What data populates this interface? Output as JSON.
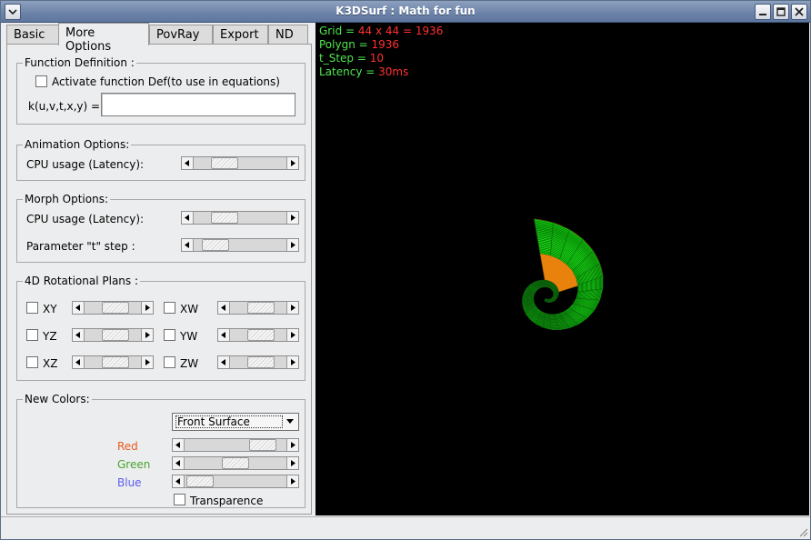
{
  "window": {
    "title": "K3DSurf : Math for fun",
    "colors": {
      "titlebar": "#6b82a8",
      "panel_bg": "#ecedee",
      "view_bg": "#000000"
    }
  },
  "tabs": [
    {
      "label": "Basic"
    },
    {
      "label": "More Options",
      "active": true
    },
    {
      "label": "PovRay"
    },
    {
      "label": "Export"
    },
    {
      "label": "ND"
    }
  ],
  "function_def": {
    "title": "Function Definition :",
    "activate_label": "Activate function Def(to use in equations)",
    "activate_checked": false,
    "k_label": "k(u,v,t,x,y) =",
    "k_value": ""
  },
  "animation": {
    "title": "Animation Options:",
    "cpu_label": "CPU usage (Latency):",
    "cpu_slider_value": 0.25
  },
  "morph": {
    "title": "Morph Options:",
    "cpu_label": "CPU usage (Latency):",
    "cpu_slider_value": 0.25,
    "tstep_label": "Parameter \"t\" step    :",
    "tstep_slider_value": 0.12
  },
  "rotational": {
    "title": "4D Rotational Plans :",
    "planes": [
      {
        "label": "XY",
        "checked": false,
        "value": 0.5
      },
      {
        "label": "XW",
        "checked": false,
        "value": 0.5
      },
      {
        "label": "YZ",
        "checked": false,
        "value": 0.5
      },
      {
        "label": "YW",
        "checked": false,
        "value": 0.5
      },
      {
        "label": "XZ",
        "checked": false,
        "value": 0.5
      },
      {
        "label": "ZW",
        "checked": false,
        "value": 0.5
      }
    ]
  },
  "colors": {
    "title": "New Colors:",
    "surface_selected": "Front Surface",
    "red_label": "Red",
    "green_label": "Green",
    "blue_label": "Blue",
    "red_value": 0.85,
    "green_value": 0.5,
    "blue_value": 0.1,
    "transparence_label": "Transparence",
    "transparence_checked": false,
    "label_colors": {
      "red": "#e85a1e",
      "green": "#46a42e",
      "blue": "#5c5cf0"
    }
  },
  "stats": {
    "grid_key": "Grid = ",
    "grid_val": "44 x 44 = 1936",
    "polygn_key": "Polygn = ",
    "polygn_val": "1936",
    "tstep_key": "t_Step = ",
    "tstep_val": "10",
    "latency_key": "Latency = ",
    "latency_val": "30ms",
    "colors": {
      "key": "#4fe44f",
      "value": "#ff3030"
    }
  },
  "surface": {
    "front_color": "#22c41a",
    "back_color": "#e8820c",
    "grid_color": "#0a5a0a"
  }
}
